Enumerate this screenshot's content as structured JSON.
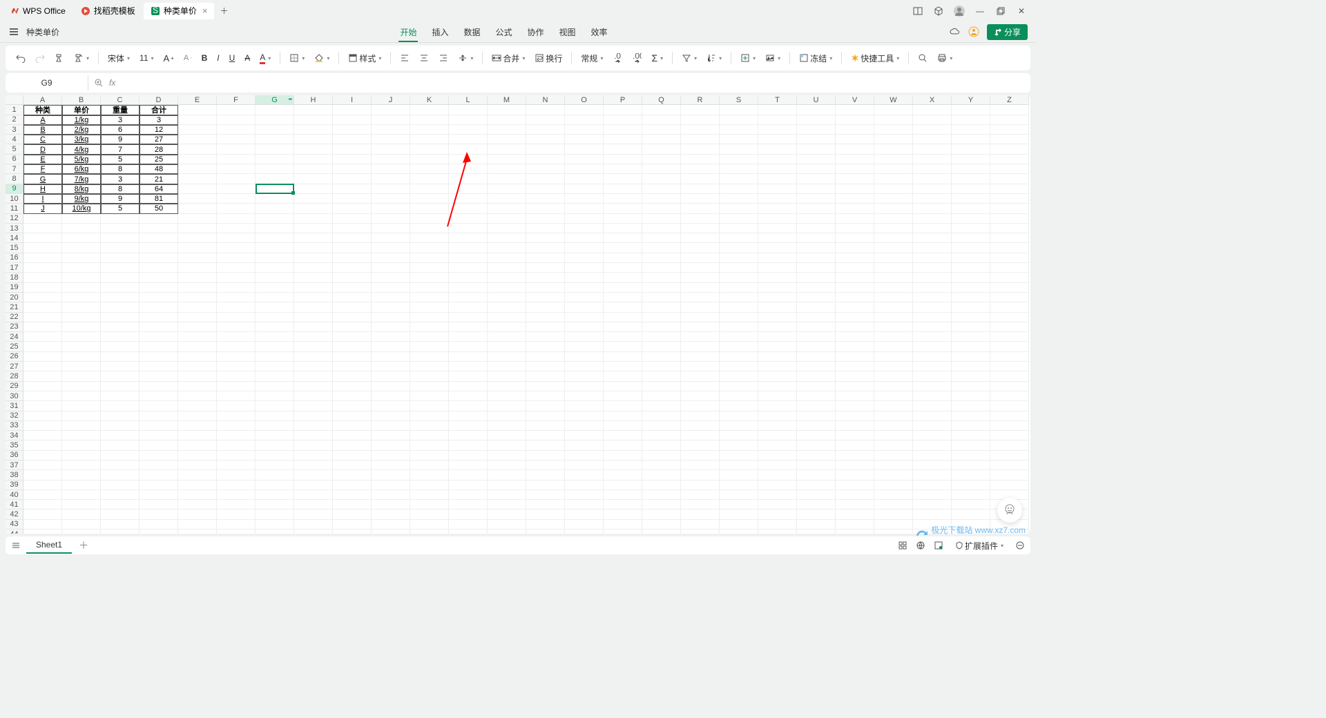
{
  "tabs": {
    "t0": "WPS Office",
    "t1": "找稻壳模板",
    "t2": "种类单价"
  },
  "docTitle": "种类单价",
  "menu": {
    "start": "开始",
    "insert": "插入",
    "data": "数据",
    "formula": "公式",
    "collab": "协作",
    "view": "视图",
    "efficiency": "效率"
  },
  "share": "分享",
  "font": {
    "name": "宋体",
    "size": "11"
  },
  "tb": {
    "style": "样式",
    "merge": "合并",
    "wrap": "换行",
    "normal": "常规",
    "freeze": "冻结",
    "quick": "快捷工具"
  },
  "cellRef": "G9",
  "cols": [
    "A",
    "B",
    "C",
    "D",
    "E",
    "F",
    "G",
    "H",
    "I",
    "J",
    "K",
    "L",
    "M",
    "N",
    "O",
    "P",
    "Q",
    "R",
    "S",
    "T",
    "U",
    "V",
    "W",
    "X",
    "Y",
    "Z"
  ],
  "sheet": {
    "headers": {
      "a": "种类",
      "b": "单价",
      "c": "重量",
      "d": "合计"
    },
    "rows": [
      {
        "a": "A",
        "b": "1/kg",
        "c": "3",
        "d": "3"
      },
      {
        "a": "B",
        "b": "2/kg",
        "c": "6",
        "d": "12"
      },
      {
        "a": "C",
        "b": "3/kg",
        "c": "9",
        "d": "27"
      },
      {
        "a": "D",
        "b": "4/kg",
        "c": "7",
        "d": "28"
      },
      {
        "a": "E",
        "b": "5/kg",
        "c": "5",
        "d": "25"
      },
      {
        "a": "F",
        "b": "6/kg",
        "c": "8",
        "d": "48"
      },
      {
        "a": "G",
        "b": "7/kg",
        "c": "3",
        "d": "21"
      },
      {
        "a": "H",
        "b": "8/kg",
        "c": "8",
        "d": "64"
      },
      {
        "a": "I",
        "b": "9/kg",
        "c": "9",
        "d": "81"
      },
      {
        "a": "J",
        "b": "10/kg",
        "c": "5",
        "d": "50"
      }
    ]
  },
  "sheetTab": "Sheet1",
  "statusbar": {
    "plugins": "扩展插件"
  },
  "watermark": "极光下载站 www.xz7.com"
}
